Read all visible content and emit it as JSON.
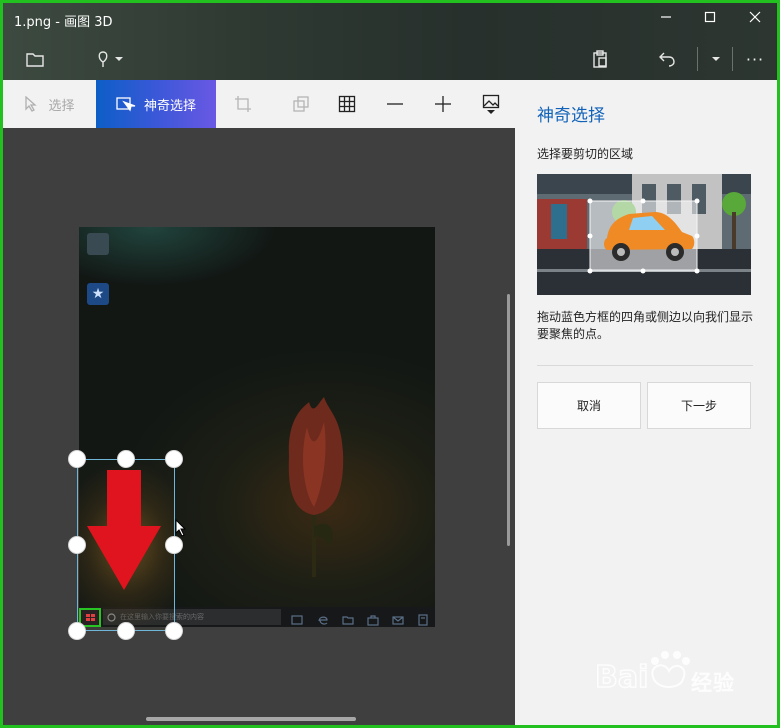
{
  "window": {
    "title": "1.png - 画图 3D",
    "minimize_icon": "minimize-icon",
    "maximize_icon": "maximize-icon",
    "close_icon": "close-icon"
  },
  "command_bar": {
    "items": [
      "folder-icon",
      "pin-icon",
      "chevron-down-icon",
      "paste-icon",
      "undo-icon",
      "chevron-down-icon",
      "more-icon"
    ],
    "more_label": "···"
  },
  "toolbar": {
    "select_label": "选择",
    "magic_select_label": "神奇选择",
    "icons": [
      "select-icon",
      "magic-select-icon",
      "crop-icon",
      "3d-view-icon",
      "grid-icon",
      "zoom-out-icon",
      "zoom-in-icon",
      "image-settings-icon"
    ]
  },
  "canvas": {
    "taskbar_search_placeholder": "在这里输入你要搜索的内容",
    "accent_color": "#6fb6d9",
    "highlight_color": "#27c424",
    "arrow_color": "#e0141e"
  },
  "panel": {
    "title": "神奇选择",
    "subtitle": "选择要剪切的区域",
    "description": "拖动蓝色方框的四角或侧边以向我们显示要聚焦的点。",
    "cancel_label": "取消",
    "next_label": "下一步",
    "title_color": "#1162b9"
  },
  "watermark": {
    "text": "经验"
  }
}
